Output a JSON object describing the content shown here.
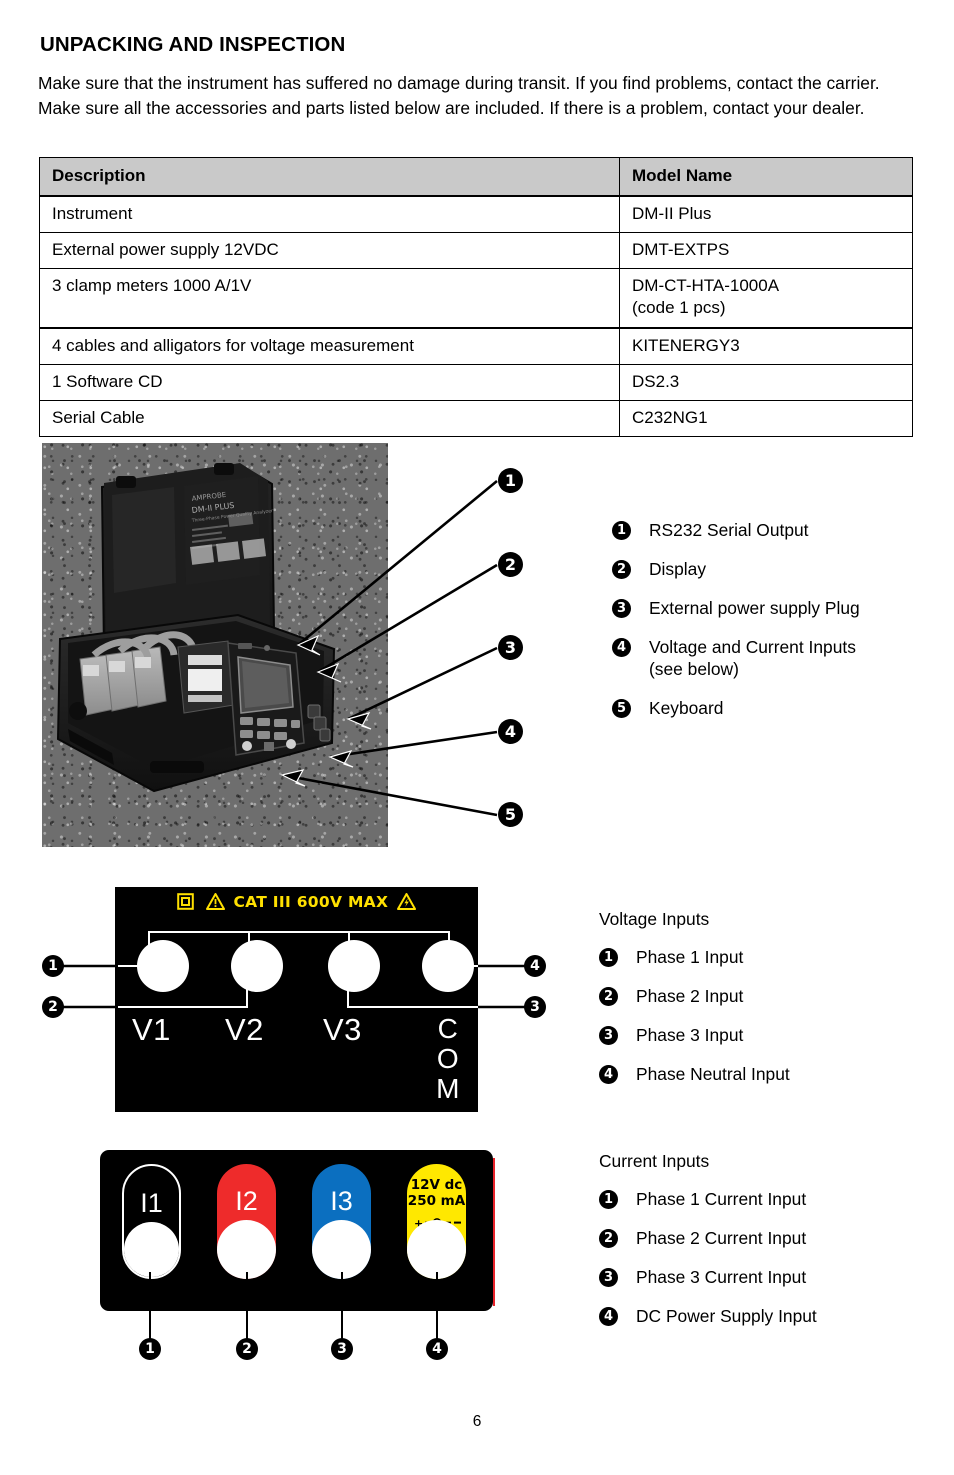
{
  "document": {
    "section_title": "UNPACKING AND INSPECTION",
    "intro_paragraph": "Make sure that the instrument has suffered no damage during transit. If you find problems, contact the carrier. Make sure all the accessories and parts listed below are included. If there is a problem, contact your dealer.",
    "page_number": "6"
  },
  "parts_table": {
    "headers": [
      "Description",
      "Model Name"
    ],
    "rows": [
      {
        "description": "Instrument",
        "model": "DM-II Plus",
        "model_sub": ""
      },
      {
        "description": "External power supply 12VDC",
        "model": "DMT-EXTPS",
        "model_sub": ""
      },
      {
        "description": "3 clamp meters 1000 A/1V",
        "model": "DM-CT-HTA-1000A",
        "model_sub": "(code 1 pcs)"
      },
      {
        "description": "4 cables and alligators for voltage measurement",
        "model": "KITENERGY3",
        "model_sub": ""
      },
      {
        "description": "1 Software CD",
        "model": "DS2.3",
        "model_sub": ""
      },
      {
        "description": "Serial Cable",
        "model": "C232NG1",
        "model_sub": ""
      }
    ]
  },
  "photo_legend": {
    "items": [
      {
        "number": "❶",
        "label": "RS232 Serial Output",
        "continuation": ""
      },
      {
        "number": "❷",
        "label": "Display",
        "continuation": ""
      },
      {
        "number": "❸",
        "label": "External power supply Plug",
        "continuation": ""
      },
      {
        "number": "❹",
        "label": "Voltage and Current Inputs",
        "continuation": "(see below)"
      },
      {
        "number": "❺",
        "label": "Keyboard",
        "continuation": ""
      }
    ],
    "callout_numbers": [
      "1",
      "2",
      "3",
      "4",
      "5"
    ]
  },
  "voltage_panel": {
    "warning_text": "CAT III 600V MAX",
    "jack_labels": [
      "V1",
      "V2",
      "V3",
      "COM"
    ],
    "callout_numbers": [
      "1",
      "2",
      "3",
      "4"
    ],
    "colors": {
      "warning": "#FFE000",
      "panel": "#000000",
      "jack": "#FFFFFF"
    }
  },
  "voltage_legend": {
    "heading": "Voltage Inputs",
    "items": [
      {
        "number": "❶",
        "label": "Phase 1 Input"
      },
      {
        "number": "❷",
        "label": "Phase 2 Input"
      },
      {
        "number": "❸",
        "label": "Phase 3 Input"
      },
      {
        "number": "❹",
        "label": "Phase Neutral Input"
      }
    ]
  },
  "current_panel": {
    "connectors": [
      {
        "label": "I1",
        "color": "#000000",
        "text_color": "#FFFFFF",
        "outlined": true
      },
      {
        "label": "I2",
        "color": "#EE2B2B",
        "text_color": "#FFFFFF",
        "outlined": false
      },
      {
        "label": "I3",
        "color": "#0B6FC0",
        "text_color": "#FFFFFF",
        "outlined": false
      },
      {
        "label": "",
        "color": "#FFE800",
        "text_color": "#000000",
        "outlined": false,
        "dc_line1": "12V dc",
        "dc_line2": "250 mA",
        "polarity_plus": "+",
        "polarity_minus": "-"
      }
    ],
    "callout_numbers": [
      "1",
      "2",
      "3",
      "4"
    ]
  },
  "current_legend": {
    "heading": "Current Inputs",
    "items": [
      {
        "number": "❶",
        "label": "Phase 1 Current Input"
      },
      {
        "number": "❷",
        "label": "Phase 2 Current Input"
      },
      {
        "number": "❸",
        "label": "Phase 3 Current Input"
      },
      {
        "number": "❹",
        "label": "DC Power Supply Input"
      }
    ]
  }
}
